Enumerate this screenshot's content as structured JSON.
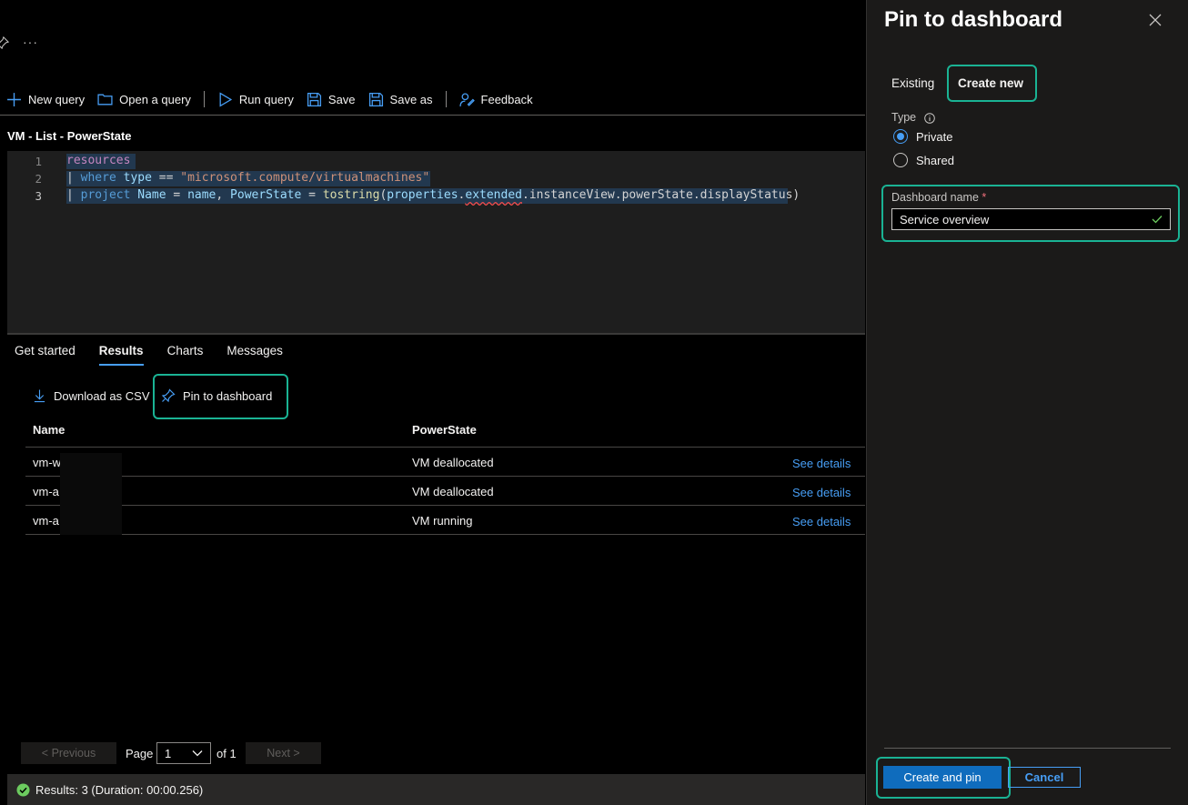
{
  "header": {
    "more_label": "···"
  },
  "toolbar": {
    "new_query": "New query",
    "open_query": "Open a query",
    "run_query": "Run query",
    "save": "Save",
    "save_as": "Save as",
    "feedback": "Feedback"
  },
  "query": {
    "title": "VM - List - PowerState",
    "lines": [
      {
        "number": "1"
      },
      {
        "number": "2"
      },
      {
        "number": "3"
      }
    ],
    "code": {
      "l1_kw": "resources",
      "l2_pipe": "| ",
      "l2_kw": "where",
      "l2_id": "type",
      "l2_op": " == ",
      "l2_str": "\"microsoft.compute/virtualmachines\"",
      "l3_pipe": "| ",
      "l3_kw": "project",
      "l3_a": "Name",
      "l3_b": " = ",
      "l3_c": "name",
      "l3_d": ", ",
      "l3_e": "PowerState",
      "l3_f": " = ",
      "l3_g": "tostring",
      "l3_h": "(",
      "l3_i": "properties",
      "l3_j": ".",
      "l3_k": "extended",
      "l3_l": ".instanceView.powerState.displayStatus)"
    }
  },
  "results_tabs": [
    "Get started",
    "Results",
    "Charts",
    "Messages"
  ],
  "actions": {
    "download_csv": "Download as CSV",
    "pin_dashboard": "Pin to dashboard"
  },
  "table": {
    "headers": [
      "Name",
      "PowerState"
    ],
    "rows": [
      {
        "name": "vm-w",
        "state": "VM deallocated",
        "link": "See details"
      },
      {
        "name": "vm-a",
        "state": "VM deallocated",
        "link": "See details"
      },
      {
        "name": "vm-a",
        "state": "VM running",
        "link": "See details"
      }
    ]
  },
  "pager": {
    "previous": "< Previous",
    "page_label": "Page",
    "page_value": "1",
    "of_label": "of 1",
    "next": "Next >"
  },
  "status": {
    "text": "Results: 3 (Duration: 00:00.256)",
    "color": "#6ccb5f"
  },
  "panel": {
    "title": "Pin to dashboard",
    "tabs": [
      "Existing",
      "Create new"
    ],
    "type_label": "Type",
    "type_options": [
      "Private",
      "Shared"
    ],
    "selected_type": "Private",
    "dashboard_name_label": "Dashboard name",
    "required_mark": "*",
    "dashboard_name_value": "Service overview",
    "primary_button": "Create and pin",
    "secondary_button": "Cancel"
  },
  "colors": {
    "accent": "#479ef5",
    "highlight": "#1ab394",
    "primary": "#0f6cbd",
    "required": "#f1707b",
    "valid": "#6ccb5f"
  }
}
